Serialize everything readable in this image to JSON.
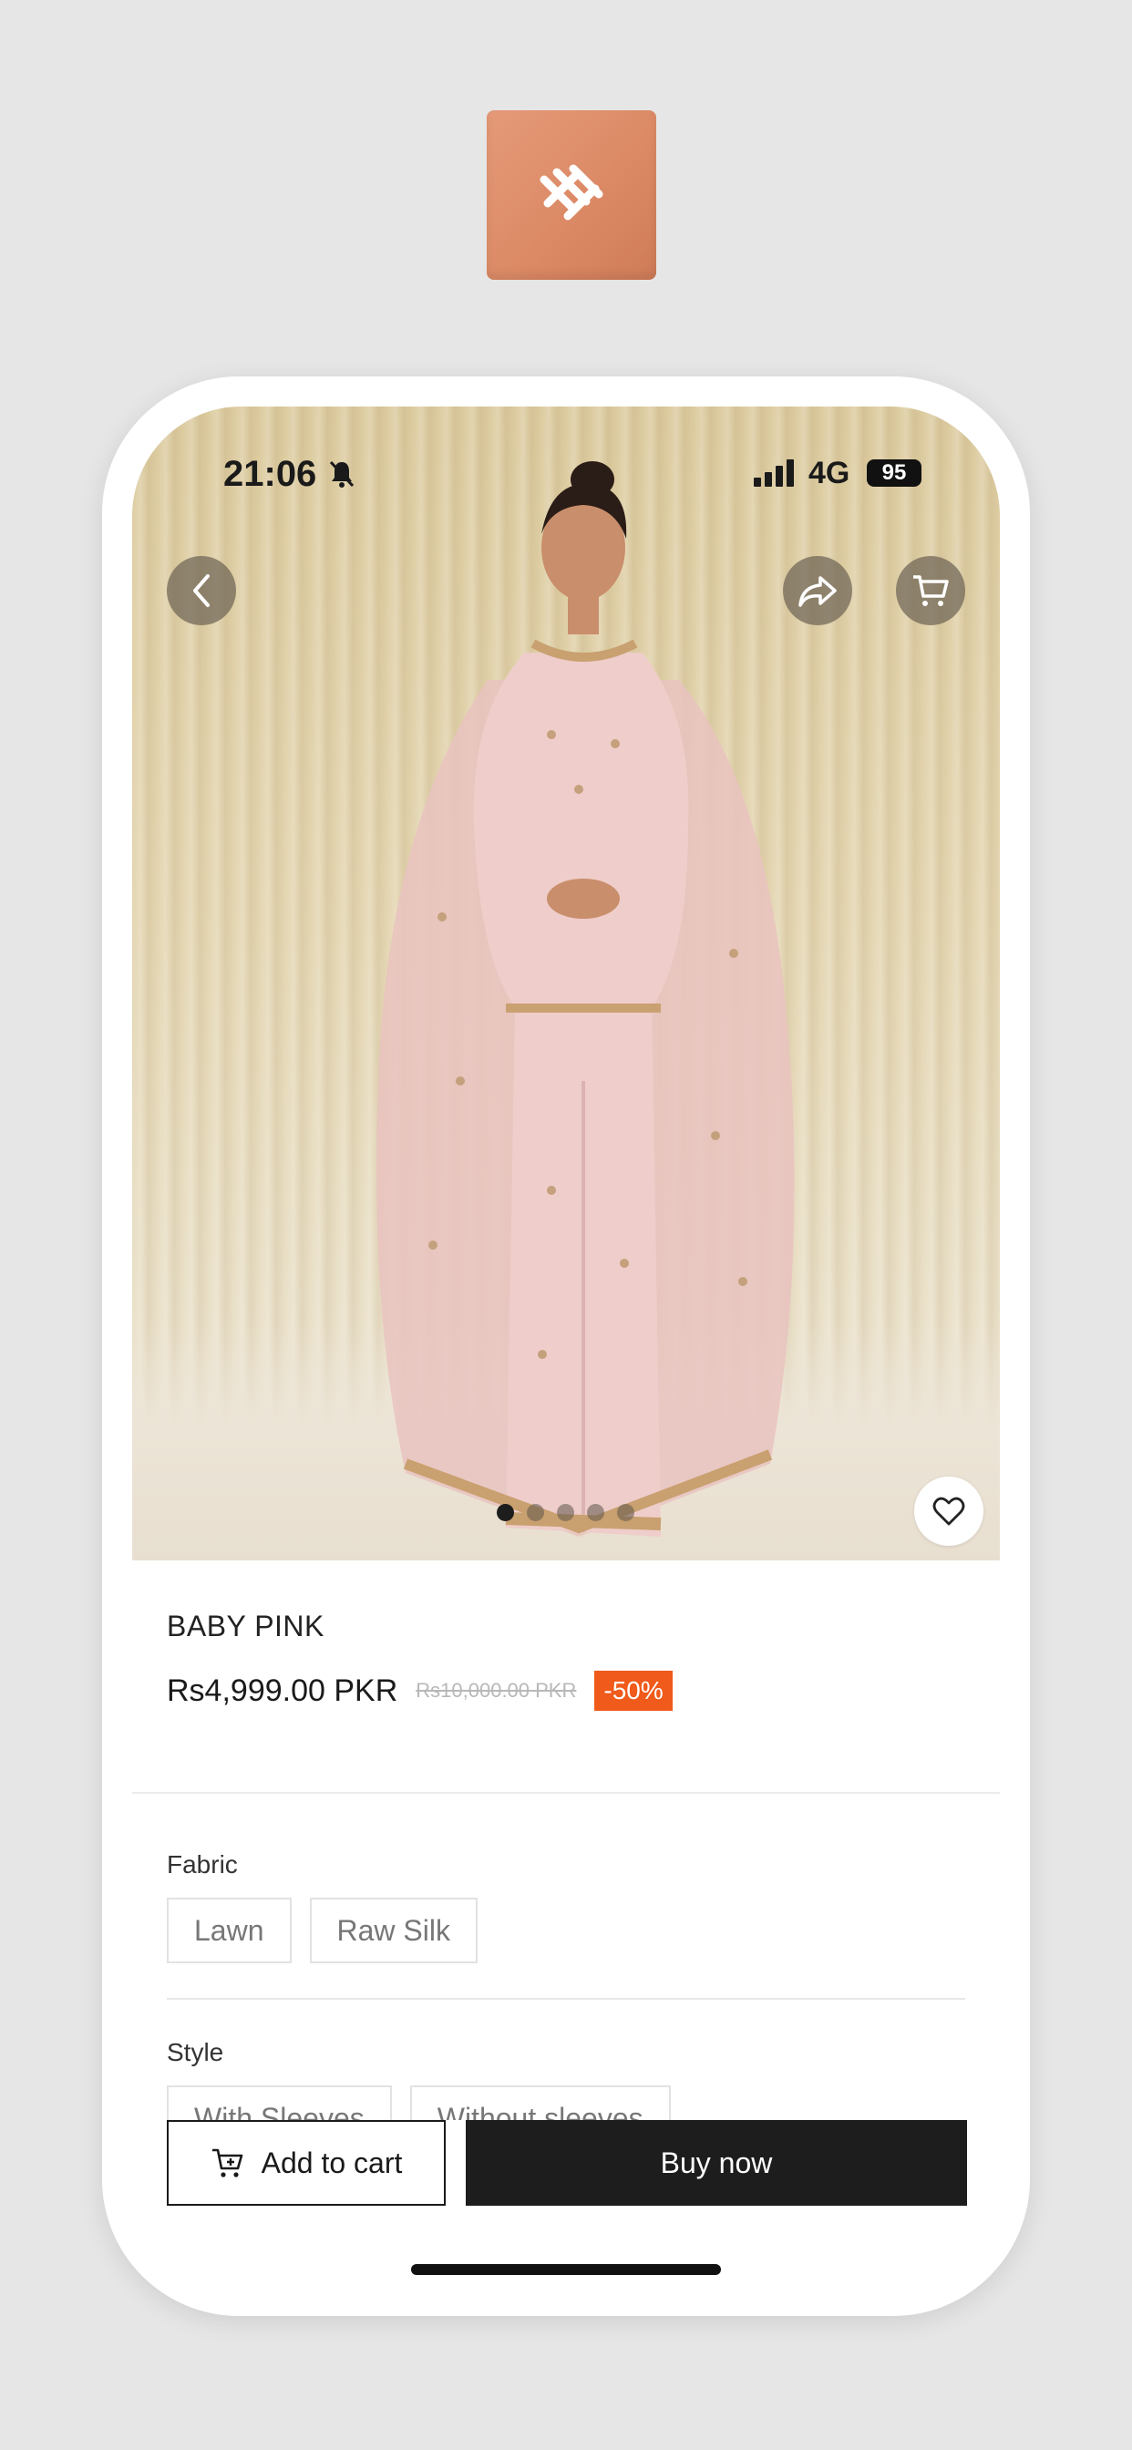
{
  "status_bar": {
    "time": "21:06",
    "network": "4G",
    "battery": "95"
  },
  "product": {
    "title": "BABY PINK",
    "price": "Rs4,999.00 PKR",
    "original_price": "Rs10,000.00 PKR",
    "discount": "-50%",
    "image_count": 5,
    "active_image_index": 0
  },
  "options": [
    {
      "label": "Fabric",
      "values": [
        "Lawn",
        "Raw Silk"
      ]
    },
    {
      "label": "Style",
      "values": [
        "With Sleeves",
        "Without sleeves"
      ]
    }
  ],
  "actions": {
    "add_to_cart": "Add to cart",
    "buy_now": "Buy now"
  },
  "colors": {
    "accent": "#f05a1a",
    "primary_button": "#1d1d1d",
    "app_icon": "#dc8a66"
  }
}
